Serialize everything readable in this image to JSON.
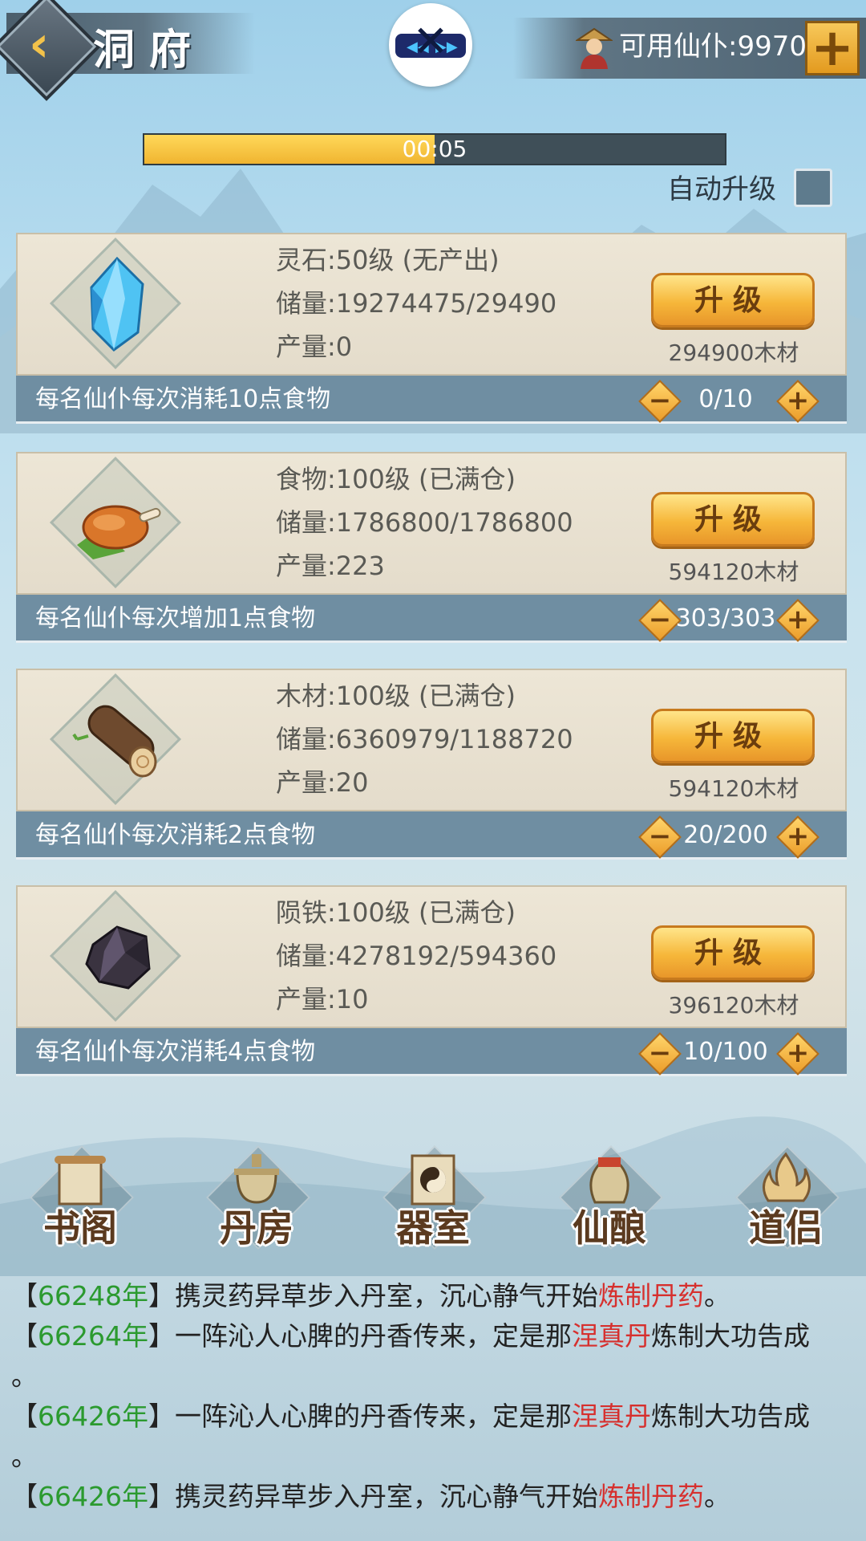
{
  "header": {
    "title": "洞府",
    "back_icon": "chevron-left-icon",
    "resource_label": "可用仙仆:9970",
    "add_icon": "plus-icon"
  },
  "progress": {
    "time_text": "00:05",
    "value": 0.5
  },
  "auto_upgrade": {
    "label": "自动升级",
    "checked": false
  },
  "resources": [
    {
      "icon": "spirit-stone-icon",
      "name_level": "灵石:50级 (无产出)",
      "storage": "储量:19274475/29490",
      "output": "产量:0",
      "upgrade_label": "升级",
      "cost": "294900木材",
      "desc": "每名仙仆每次消耗10点食物",
      "count": "0/10"
    },
    {
      "icon": "roast-meat-icon",
      "name_level": "食物:100级 (已满仓)",
      "storage": "储量:1786800/1786800",
      "output": "产量:223",
      "upgrade_label": "升级",
      "cost": "594120木材",
      "desc": "每名仙仆每次增加1点食物",
      "count": "303/303"
    },
    {
      "icon": "wood-log-icon",
      "name_level": "木材:100级 (已满仓)",
      "storage": "储量:6360979/1188720",
      "output": "产量:20",
      "upgrade_label": "升级",
      "cost": "594120木材",
      "desc": "每名仙仆每次消耗2点食物",
      "count": "20/200"
    },
    {
      "icon": "meteor-iron-icon",
      "name_level": "陨铁:100级 (已满仓)",
      "storage": "储量:4278192/594360",
      "output": "产量:10",
      "upgrade_label": "升级",
      "cost": "396120木材",
      "desc": "每名仙仆每次消耗4点食物",
      "count": "10/100"
    }
  ],
  "buildings": [
    {
      "name": "书阁",
      "icon": "scroll-icon"
    },
    {
      "name": "丹房",
      "icon": "cauldron-icon"
    },
    {
      "name": "器室",
      "icon": "yin-yang-banner-icon"
    },
    {
      "name": "仙酿",
      "icon": "wine-jar-icon"
    },
    {
      "name": "道侣",
      "icon": "flame-icon"
    }
  ],
  "log": [
    {
      "open": "【",
      "year": "66248年",
      "close": "】",
      "text": "携灵药异草步入丹室，沉心静气开始",
      "highlight": "炼制丹药",
      "after": "。"
    },
    {
      "open": "【",
      "year": "66264年",
      "close": "】",
      "text": "一阵沁人心脾的丹香传来，定是那",
      "highlight": "涅真丹",
      "after": "炼制大功告成",
      "wrap": "。"
    },
    {
      "open": "【",
      "year": "66426年",
      "close": "】",
      "text": "一阵沁人心脾的丹香传来，定是那",
      "highlight": "涅真丹",
      "after": "炼制大功告成",
      "wrap": "。"
    },
    {
      "open": "【",
      "year": "66426年",
      "close": "】",
      "text": "携灵药异草步入丹室，沉心静气开始",
      "highlight": "炼制丹药",
      "after": "。"
    }
  ],
  "colors": {
    "year": "#2b9a2f",
    "highlight": "#d6302e",
    "button": "#f6b73a"
  }
}
